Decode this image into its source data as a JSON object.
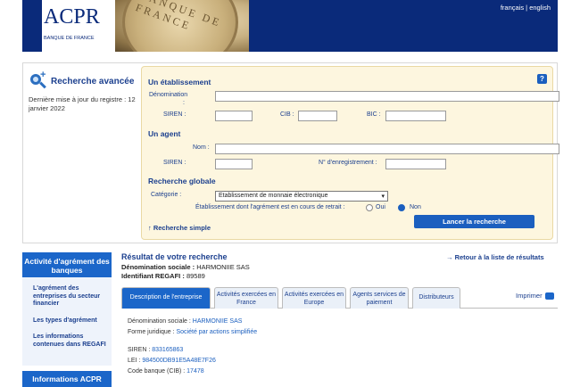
{
  "header": {
    "logo_text": "ACPR",
    "logo_sub": "BANQUE DE FRANCE",
    "seal_text": "BANQUE DE FRANCE",
    "lang_fr": "français",
    "lang_sep": "|",
    "lang_en": "english"
  },
  "search": {
    "title": "Recherche avancée",
    "update": "Dernière mise à jour du registre : 12 janvier 2022",
    "help": "?",
    "etab": {
      "heading": "Un établissement",
      "denomination_label": "Dénomination",
      "denomination_colon": ":",
      "siren_label": "SIREN :",
      "cib_label": "CIB :",
      "bic_label": "BIC :"
    },
    "agent": {
      "heading": "Un agent",
      "nom_label": "Nom :",
      "siren_label": "SIREN :",
      "num_label": "N° d'enregistrement :"
    },
    "global": {
      "heading": "Recherche globale",
      "category_label": "Catégorie :",
      "category_value": "Etablissement de monnaie électronique",
      "retrait_label": "Établissement dont l'agrément est en cours de retrait :",
      "oui": "Oui",
      "non": "Non"
    },
    "simple_link": "↑ Recherche simple",
    "submit": "Lancer la recherche"
  },
  "sidebar": {
    "heading": "Activité d'agrément des banques",
    "links": [
      "L'agrément des entreprises du secteur financier",
      "Les types d'agrément",
      "Les informations contenues dans REGAFI"
    ],
    "heading2": "Informations ACPR"
  },
  "result": {
    "title": "Résultat de votre recherche",
    "denom_label": "Dénomination sociale :",
    "denom_value": "HARMONIIE SAS",
    "id_label": "Identifiant REGAFI :",
    "id_value": "89589",
    "back_link": "→ Retour à la liste de résultats",
    "print": "Imprimer",
    "tabs": [
      "Description de l'entreprise",
      "Activités exercées en France",
      "Activités exercées en Europe",
      "Agents services de paiement",
      "Distributeurs"
    ],
    "details": {
      "denom_label": "Dénomination sociale :",
      "denom_value": "HARMONIIE SAS",
      "forme_label": "Forme juridique :",
      "forme_value": "Société par actions simplifiée",
      "siren_label": "SIREN :",
      "siren_value": "833165863",
      "lei_label": "LEI :",
      "lei_value": "984500DB91E5A48E7F26",
      "cib_label": "Code banque (CIB) :",
      "cib_value": "17478"
    }
  }
}
